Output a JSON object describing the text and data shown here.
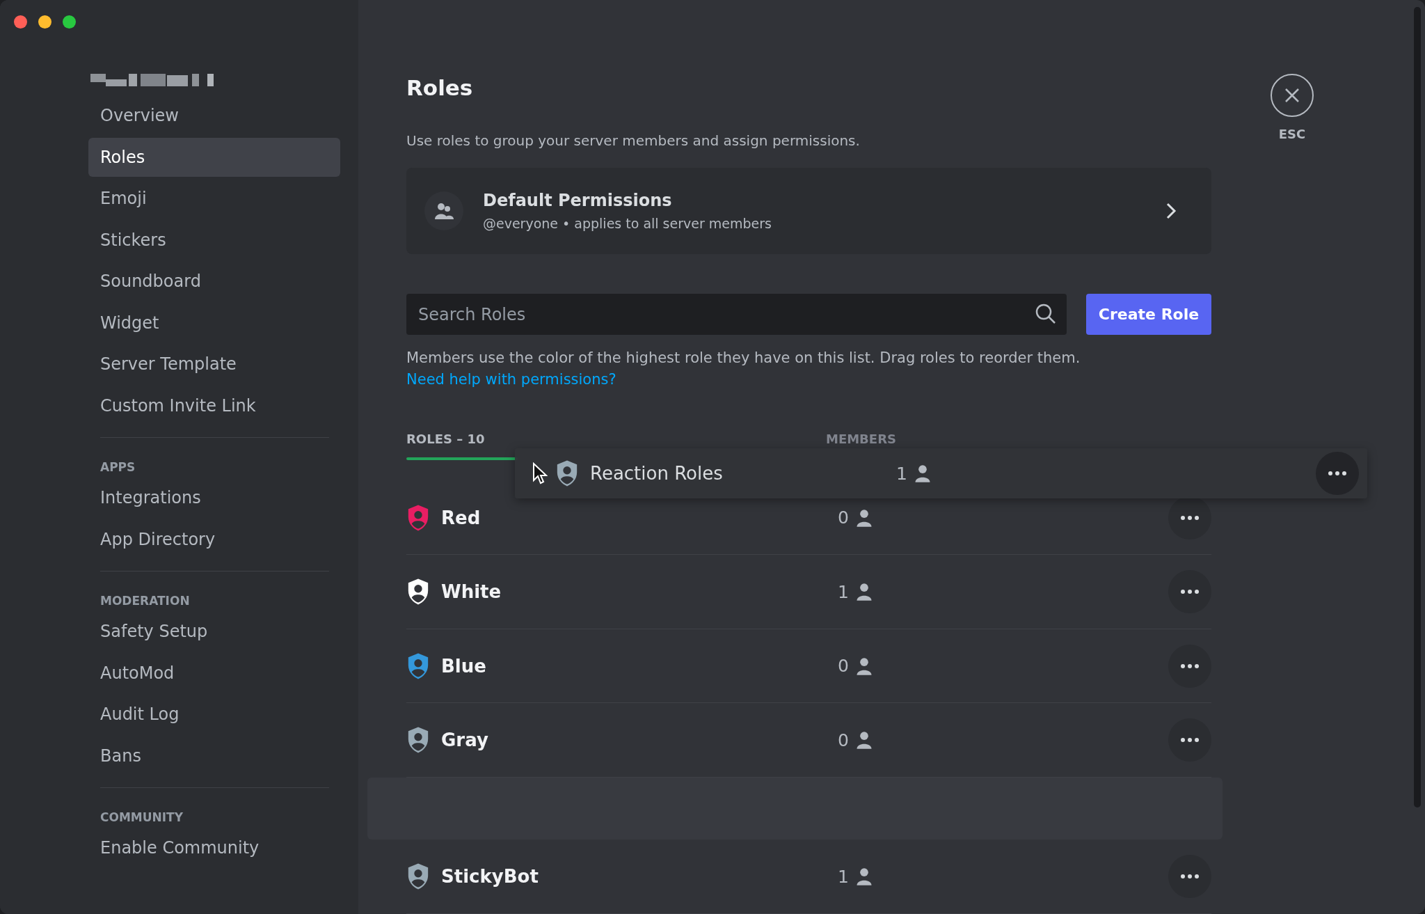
{
  "sidebar": {
    "sections": [
      {
        "items": [
          {
            "label": "Overview",
            "selected": false
          },
          {
            "label": "Roles",
            "selected": true
          },
          {
            "label": "Emoji",
            "selected": false
          },
          {
            "label": "Stickers",
            "selected": false
          },
          {
            "label": "Soundboard",
            "selected": false
          },
          {
            "label": "Widget",
            "selected": false
          },
          {
            "label": "Server Template",
            "selected": false
          },
          {
            "label": "Custom Invite Link",
            "selected": false
          }
        ]
      },
      {
        "header": "APPS",
        "items": [
          {
            "label": "Integrations",
            "selected": false
          },
          {
            "label": "App Directory",
            "selected": false
          }
        ]
      },
      {
        "header": "MODERATION",
        "items": [
          {
            "label": "Safety Setup",
            "selected": false
          },
          {
            "label": "AutoMod",
            "selected": false
          },
          {
            "label": "Audit Log",
            "selected": false
          },
          {
            "label": "Bans",
            "selected": false
          }
        ]
      },
      {
        "header": "COMMUNITY",
        "items": [
          {
            "label": "Enable Community",
            "selected": false
          }
        ]
      }
    ]
  },
  "page": {
    "title": "Roles",
    "subtitle": "Use roles to group your server members and assign permissions.",
    "close_label": "ESC"
  },
  "default_permissions": {
    "title": "Default Permissions",
    "subtitle": "@everyone • applies to all server members"
  },
  "search": {
    "placeholder": "Search Roles"
  },
  "create_button": "Create Role",
  "help": {
    "text": "Members use the color of the highest role they have on this list. Drag roles to reorder them.",
    "link": "Need help with permissions?"
  },
  "roles_table": {
    "header": "ROLES – 10",
    "members_header": "MEMBERS",
    "dragging": {
      "name": "Reaction Roles",
      "members": "1",
      "color": "#99aab5"
    },
    "rows": [
      {
        "kind": "role",
        "name": "Red",
        "members": "0",
        "color": "#e91e63"
      },
      {
        "kind": "role",
        "name": "White",
        "members": "1",
        "color": "#ffffff"
      },
      {
        "kind": "role",
        "name": "Blue",
        "members": "0",
        "color": "#3498db"
      },
      {
        "kind": "role",
        "name": "Gray",
        "members": "0",
        "color": "#99aab5"
      },
      {
        "kind": "drop_target"
      },
      {
        "kind": "role",
        "name": "StickyBot",
        "members": "1",
        "color": "#99aab5"
      }
    ]
  }
}
